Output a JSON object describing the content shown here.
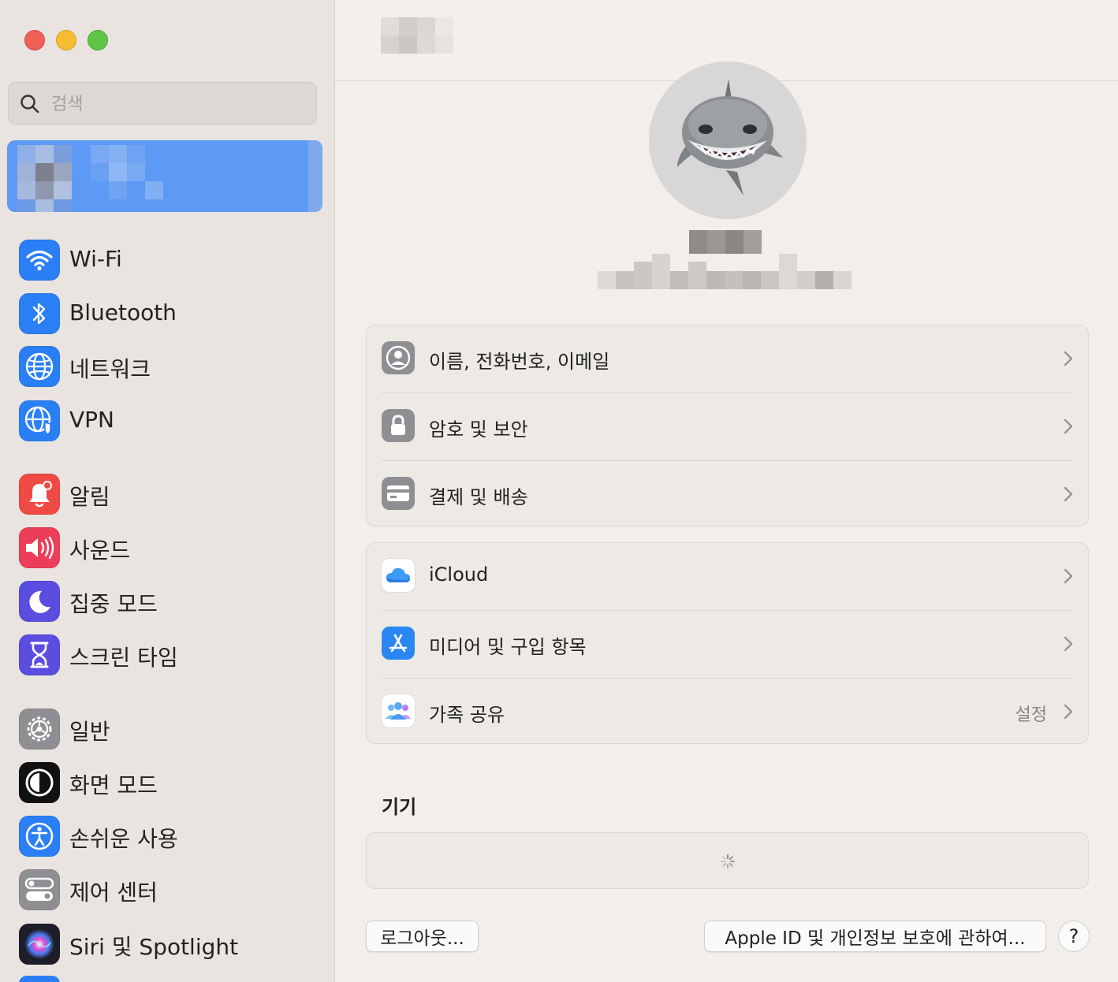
{
  "sidebar": {
    "search": {
      "placeholder": "검색"
    },
    "sections": [
      [
        {
          "label": "Wi-Fi",
          "icon": "wifi-icon",
          "color": "#2b7ff5"
        },
        {
          "label": "Bluetooth",
          "icon": "bluetooth-icon",
          "color": "#2b7ff5"
        },
        {
          "label": "네트워크",
          "icon": "network-globe-icon",
          "color": "#2b7ff5"
        },
        {
          "label": "VPN",
          "icon": "vpn-globe-icon",
          "color": "#2b7ff5"
        }
      ],
      [
        {
          "label": "알림",
          "icon": "bell-icon",
          "color": "#ef4a43"
        },
        {
          "label": "사운드",
          "icon": "speaker-icon",
          "color": "#ec3e59"
        },
        {
          "label": "집중 모드",
          "icon": "moon-icon",
          "color": "#5a4ee0"
        },
        {
          "label": "스크린 타임",
          "icon": "hourglass-icon",
          "color": "#5a4ee0"
        }
      ],
      [
        {
          "label": "일반",
          "icon": "gear-icon",
          "color": "#8e8e93"
        },
        {
          "label": "화면 모드",
          "icon": "appearance-icon",
          "color": "#111111"
        },
        {
          "label": "손쉬운 사용",
          "icon": "accessibility-icon",
          "color": "#2b7ff5"
        },
        {
          "label": "제어 센터",
          "icon": "control-center-icon",
          "color": "#8e8e93"
        },
        {
          "label": "Siri 및 Spotlight",
          "icon": "siri-icon",
          "color": "#2a2a2a"
        }
      ]
    ]
  },
  "main": {
    "account_group": [
      {
        "label": "이름, 전화번호, 이메일",
        "icon": "person-circle-icon"
      },
      {
        "label": "암호 및 보안",
        "icon": "lock-icon"
      },
      {
        "label": "결제 및 배송",
        "icon": "credit-card-icon"
      }
    ],
    "services_group": [
      {
        "label": "iCloud",
        "icon": "icloud-icon"
      },
      {
        "label": "미디어 및 구입 항목",
        "icon": "app-store-icon"
      },
      {
        "label": "가족 공유",
        "icon": "family-sharing-icon",
        "value": "설정"
      }
    ],
    "devices_header": "기기",
    "buttons": {
      "logout": "로그아웃...",
      "privacy": "Apple ID 및 개인정보 보호에 관하여...",
      "help": "?"
    }
  }
}
